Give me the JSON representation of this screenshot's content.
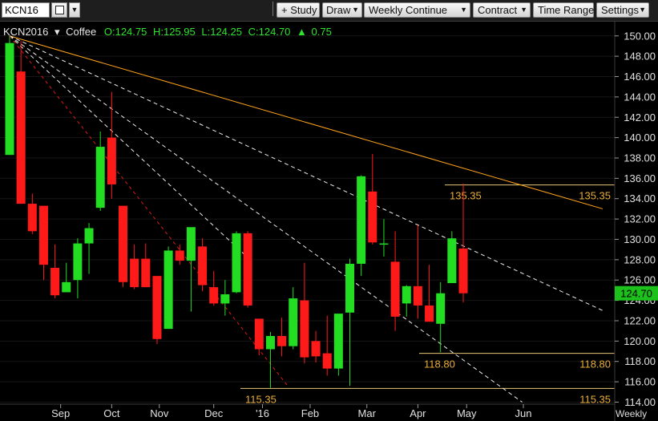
{
  "toolbar": {
    "symbol": "KCN16",
    "study": "+ Study",
    "draw": "Draw",
    "period": "Weekly Continue",
    "contract": "Contract",
    "time_range": "Time Range",
    "settings": "Settings"
  },
  "header": {
    "name": "KCN2016",
    "desc": "Coffee",
    "open": "O:124.75",
    "high": "H:125.95",
    "low": "L:124.25",
    "close": "C:124.70",
    "change": "0.75"
  },
  "colors": {
    "up": "#22dd22",
    "down": "#ff1a1a",
    "trend": "#ffa31a",
    "level": "#e6c878",
    "price_tag": "#1cc11c"
  },
  "last_price_label": "124.70",
  "period_label": "Weekly",
  "chart_data": {
    "type": "candlestick",
    "ylim": [
      113.8,
      151.4
    ],
    "yticks": [
      114,
      116,
      118,
      120,
      122,
      124,
      126,
      128,
      130,
      132,
      134,
      136,
      138,
      140,
      142,
      144,
      146,
      148,
      150
    ],
    "ytick_labels": [
      "114.00",
      "116.00",
      "118.00",
      "120.00",
      "122.00",
      "124.00",
      "126.00",
      "128.00",
      "130.00",
      "132.00",
      "134.00",
      "136.00",
      "138.00",
      "140.00",
      "142.00",
      "144.00",
      "146.00",
      "148.00",
      "150.00"
    ],
    "xtick_labels": [
      "Sep",
      "Oct",
      "Nov",
      "Dec",
      "'16",
      "Feb",
      "Mar",
      "Apr",
      "May",
      "Jun"
    ],
    "xtick_index": [
      4.5,
      9,
      13.2,
      18,
      22.3,
      26.5,
      31.5,
      36,
      40.3,
      45.3
    ],
    "candles": [
      {
        "o": 138.3,
        "h": 150,
        "l": 138.3,
        "c": 149.3
      },
      {
        "o": 146.5,
        "h": 149.5,
        "l": 133.5,
        "c": 133.5
      },
      {
        "o": 133.5,
        "h": 134.5,
        "l": 130.5,
        "c": 130.8
      },
      {
        "o": 133.3,
        "h": 133.3,
        "l": 126,
        "c": 127.5
      },
      {
        "o": 127.2,
        "h": 129.5,
        "l": 124.2,
        "c": 124.5
      },
      {
        "o": 124.8,
        "h": 127.7,
        "l": 124.8,
        "c": 125.8
      },
      {
        "o": 126,
        "h": 130.1,
        "l": 124.2,
        "c": 129.6
      },
      {
        "o": 129.6,
        "h": 131.6,
        "l": 126.6,
        "c": 131.1
      },
      {
        "o": 133.1,
        "h": 140.6,
        "l": 132.8,
        "c": 139.1
      },
      {
        "o": 140,
        "h": 144.5,
        "l": 134,
        "c": 135.4
      },
      {
        "o": 133.3,
        "h": 133.3,
        "l": 125.3,
        "c": 125.8
      },
      {
        "o": 128.1,
        "h": 129.5,
        "l": 125.1,
        "c": 125.3
      },
      {
        "o": 128.1,
        "h": 129.6,
        "l": 125.3,
        "c": 125.3
      },
      {
        "o": 126.4,
        "h": 126.4,
        "l": 119.7,
        "c": 120.2
      },
      {
        "o": 121.2,
        "h": 129.3,
        "l": 121.2,
        "c": 128.9
      },
      {
        "o": 128.9,
        "h": 129.5,
        "l": 127.5,
        "c": 127.9
      },
      {
        "o": 127.9,
        "h": 130.1,
        "l": 122.9,
        "c": 131.2
      },
      {
        "o": 129.3,
        "h": 130.1,
        "l": 124.9,
        "c": 125.5
      },
      {
        "o": 125.3,
        "h": 126.9,
        "l": 123.5,
        "c": 123.7
      },
      {
        "o": 123.7,
        "h": 126,
        "l": 122.5,
        "c": 124.6
      },
      {
        "o": 124.8,
        "h": 130.8,
        "l": 124.7,
        "c": 130.6
      },
      {
        "o": 130.6,
        "h": 130.8,
        "l": 123.3,
        "c": 123.5
      },
      {
        "o": 122.2,
        "h": 122.2,
        "l": 118.6,
        "c": 119.2
      },
      {
        "o": 119.2,
        "h": 120.9,
        "l": 115.4,
        "c": 120.5
      },
      {
        "o": 120.5,
        "h": 122.3,
        "l": 118.5,
        "c": 119.5
      },
      {
        "o": 119.5,
        "h": 125.3,
        "l": 119.2,
        "c": 124.2
      },
      {
        "o": 124,
        "h": 127.7,
        "l": 117.8,
        "c": 118.4
      },
      {
        "o": 120,
        "h": 121,
        "l": 117.9,
        "c": 118.5
      },
      {
        "o": 118.8,
        "h": 122.5,
        "l": 116.6,
        "c": 117.3
      },
      {
        "o": 117.3,
        "h": 122.2,
        "l": 116.6,
        "c": 122.7
      },
      {
        "o": 122.8,
        "h": 128.1,
        "l": 115.6,
        "c": 127.6
      },
      {
        "o": 127.6,
        "h": 136.3,
        "l": 126.4,
        "c": 136.2
      },
      {
        "o": 134.7,
        "h": 138.4,
        "l": 129.5,
        "c": 129.7
      },
      {
        "o": 129.5,
        "h": 132,
        "l": 128.3,
        "c": 129.6
      },
      {
        "o": 127.8,
        "h": 130.8,
        "l": 121,
        "c": 122.4
      },
      {
        "o": 123.7,
        "h": 125.5,
        "l": 122.4,
        "c": 125.4
      },
      {
        "o": 125.4,
        "h": 131.4,
        "l": 122.2,
        "c": 123.5
      },
      {
        "o": 123.5,
        "h": 127.5,
        "l": 122.3,
        "c": 121.9
      },
      {
        "o": 121.7,
        "h": 125.8,
        "l": 118.9,
        "c": 124.7
      },
      {
        "o": 125.7,
        "h": 130.8,
        "l": 125.7,
        "c": 130.1
      },
      {
        "o": 129.1,
        "h": 135.5,
        "l": 123.8,
        "c": 124.7
      }
    ],
    "horizontal_levels": [
      {
        "value": 135.35,
        "label_left": "135.35",
        "label_right": "135.35"
      },
      {
        "value": 118.8,
        "label_left": "118.80",
        "label_right": "118.80"
      },
      {
        "value": 115.35,
        "label_left": "115.35",
        "label_right": "115.35"
      }
    ],
    "trend_lines": [
      {
        "kind": "solid-orange",
        "from": [
          0,
          150
        ],
        "to": [
          52.3,
          133
        ]
      },
      {
        "kind": "dashed-white",
        "from": [
          0,
          150
        ],
        "to": [
          52.3,
          123
        ]
      },
      {
        "kind": "dashed-white",
        "from": [
          0,
          150
        ],
        "to": [
          45.2,
          114
        ]
      },
      {
        "kind": "dashed-white",
        "from": [
          0,
          150
        ],
        "to": [
          21.2,
          128
        ]
      },
      {
        "kind": "dashed-red",
        "from": [
          0,
          150
        ],
        "to": [
          24.6,
          115.5
        ]
      }
    ]
  }
}
